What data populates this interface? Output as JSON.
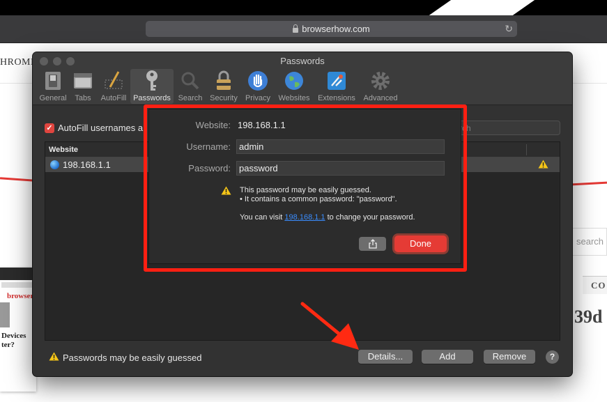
{
  "browser": {
    "url": "browserhow.com"
  },
  "background_page": {
    "nav_text": "HROME",
    "search_placeholder": "search",
    "section_label": "CO",
    "heading_fragment": "39d",
    "thumb_brand": "browser",
    "thumb_title_lines": [
      "Devices",
      "ter?"
    ]
  },
  "preferences": {
    "title": "Passwords",
    "tabs": [
      {
        "label": "General",
        "icon": "general-switch-icon"
      },
      {
        "label": "Tabs",
        "icon": "tabs-icon"
      },
      {
        "label": "AutoFill",
        "icon": "autofill-pencil-icon"
      },
      {
        "label": "Passwords",
        "icon": "key-icon"
      },
      {
        "label": "Search",
        "icon": "magnifier-icon"
      },
      {
        "label": "Security",
        "icon": "padlock-icon"
      },
      {
        "label": "Privacy",
        "icon": "hand-icon"
      },
      {
        "label": "Websites",
        "icon": "globe-icon"
      },
      {
        "label": "Extensions",
        "icon": "puzzle-icon"
      },
      {
        "label": "Advanced",
        "icon": "gear-icon"
      }
    ],
    "active_tab": "Passwords",
    "autofill_label": "AutoFill usernames a",
    "autofill_checked": true,
    "search_placeholder": "rch",
    "table": {
      "column_website": "Website",
      "rows": [
        {
          "website": "198.168.1.1",
          "warning": true
        }
      ]
    },
    "footer_warning": "Passwords may be easily guessed",
    "buttons": {
      "details": "Details...",
      "add": "Add",
      "remove": "Remove",
      "help": "?"
    }
  },
  "details_sheet": {
    "website_label": "Website:",
    "website_value": "198.168.1.1",
    "username_label": "Username:",
    "username_value": "admin",
    "password_label": "Password:",
    "password_value": "password",
    "warning_line1": "This password may be easily guessed.",
    "warning_line2": "• It contains a common password: \"password\".",
    "visit_prefix": "You can visit ",
    "visit_link": "198.168.1.1",
    "visit_suffix": " to change your password.",
    "done_label": "Done"
  },
  "colors": {
    "accent_red": "#e53b35",
    "annotation_red": "#ff1f12",
    "link_blue": "#3a8dff",
    "warning_yellow": "#f5c518"
  }
}
